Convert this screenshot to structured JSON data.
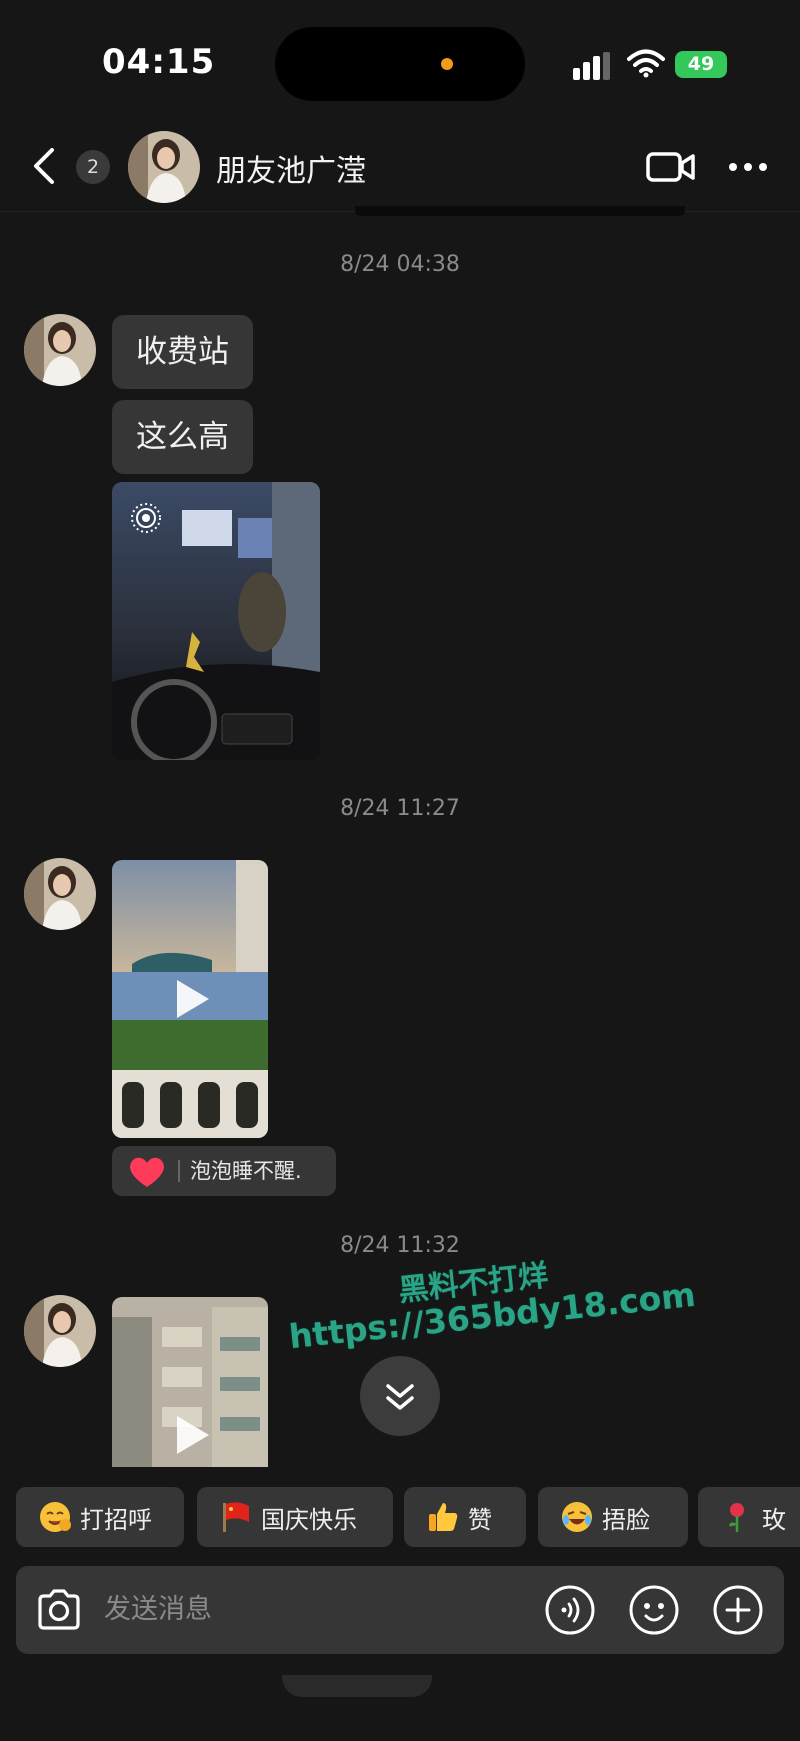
{
  "status_bar": {
    "time": "04:15",
    "battery": "49"
  },
  "header": {
    "unread_count": "2",
    "title": "朋友池广滢"
  },
  "messages": {
    "timestamp_1": "8/24 04:38",
    "text_1": "收费站",
    "text_2": "这么高",
    "timestamp_2": "8/24 11:27",
    "reaction_name": "泡泡睡不醒.",
    "timestamp_3": "8/24 11:32"
  },
  "watermark": {
    "line1": "黑料不打烊",
    "line2": "https://365bdy18.com"
  },
  "quick_replies": [
    {
      "label": "打招呼",
      "icon": "waving-smile-emoji"
    },
    {
      "label": "国庆快乐",
      "icon": "red-flag-emoji"
    },
    {
      "label": "赞",
      "icon": "thumbs-up-emoji"
    },
    {
      "label": "捂脸",
      "icon": "facepalm-laugh-emoji"
    },
    {
      "label": "玫",
      "icon": "rose-emoji"
    }
  ],
  "composer": {
    "placeholder": "发送消息"
  },
  "colors": {
    "background": "#161616",
    "bubble": "#363636",
    "battery": "#34c759",
    "watermark": "#2aa386"
  }
}
